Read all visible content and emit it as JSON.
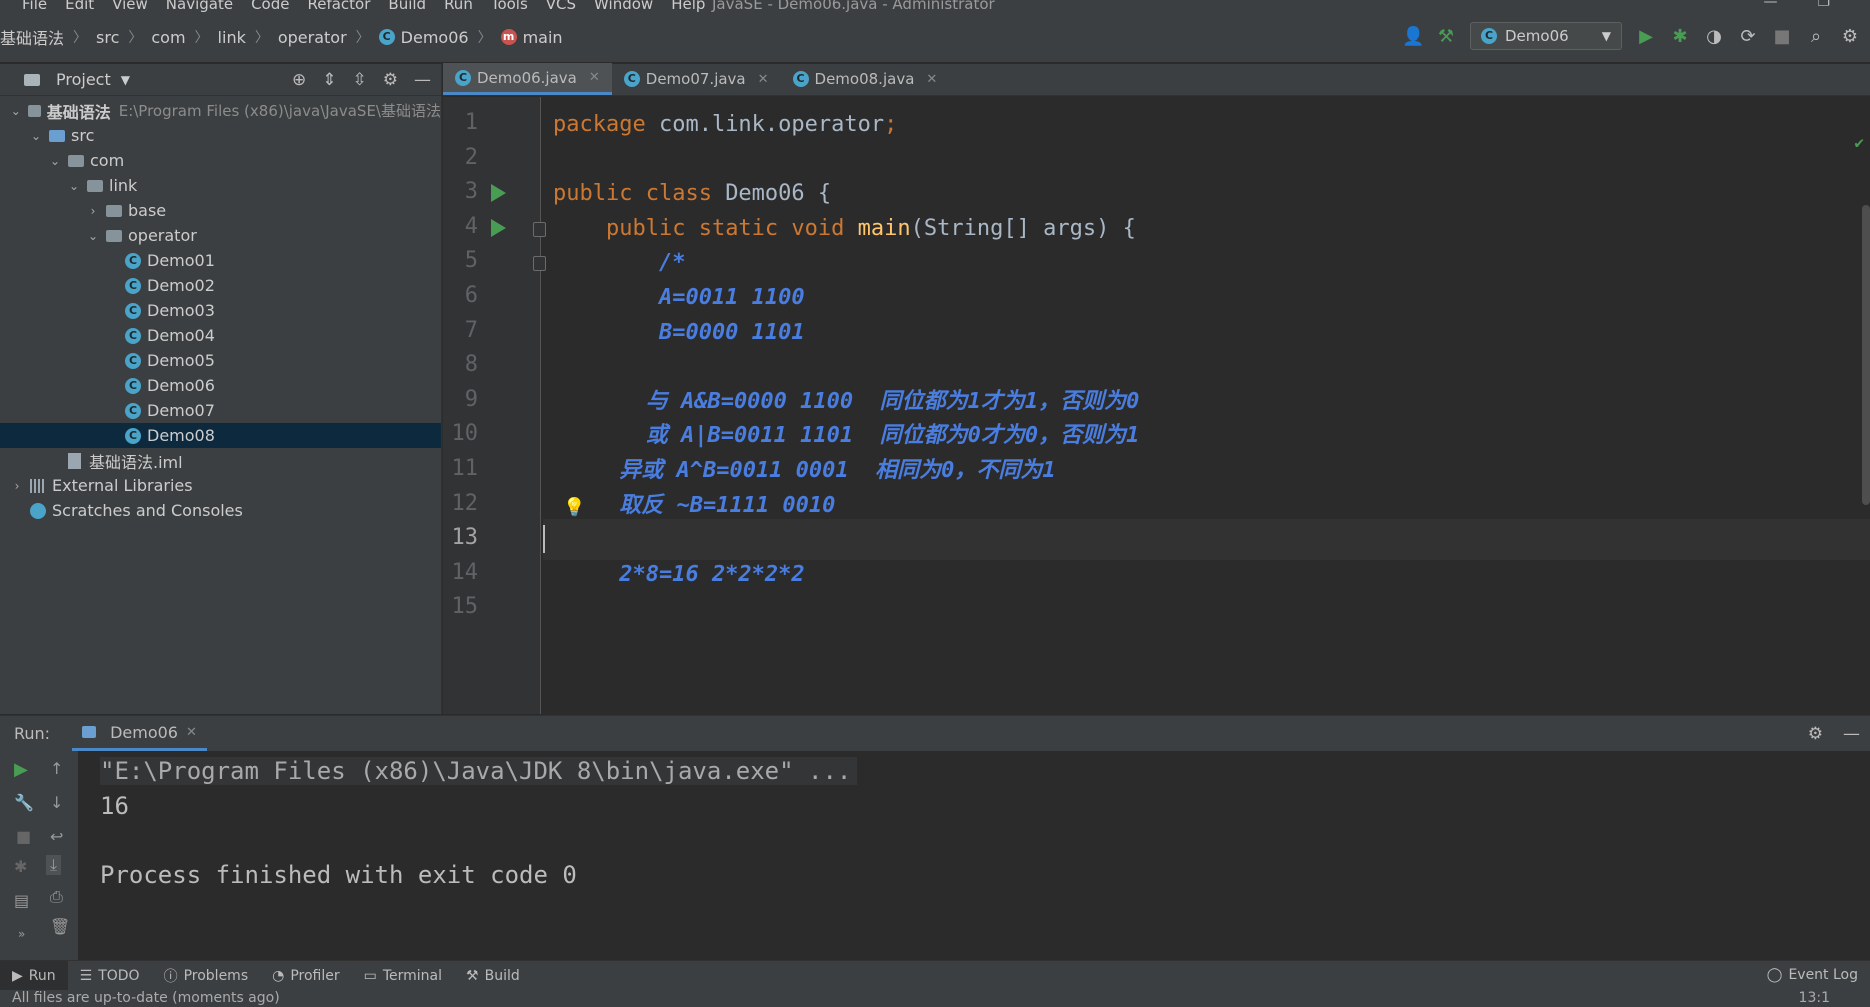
{
  "menu": {
    "items": [
      "File",
      "Edit",
      "View",
      "Navigate",
      "Code",
      "Refactor",
      "Build",
      "Run",
      "Tools",
      "VCS",
      "Window",
      "Help"
    ],
    "window_title": "JavaSE - Demo06.java - Administrator"
  },
  "breadcrumbs": [
    "基础语法",
    "src",
    "com",
    "link",
    "operator",
    "Demo06",
    "main"
  ],
  "toolbar": {
    "run_config": "Demo06"
  },
  "project": {
    "header": "Project",
    "tree": [
      {
        "label": "基础语法",
        "path": "E:\\Program Files (x86)\\java\\JavaSE\\基础语法",
        "depth": 0,
        "kind": "module",
        "expanded": true
      },
      {
        "label": "src",
        "depth": 1,
        "kind": "src",
        "expanded": true
      },
      {
        "label": "com",
        "depth": 2,
        "kind": "package",
        "expanded": true
      },
      {
        "label": "link",
        "depth": 3,
        "kind": "package",
        "expanded": true
      },
      {
        "label": "base",
        "depth": 4,
        "kind": "package",
        "expanded": false
      },
      {
        "label": "operator",
        "depth": 4,
        "kind": "package",
        "expanded": true
      },
      {
        "label": "Demo01",
        "depth": 5,
        "kind": "class"
      },
      {
        "label": "Demo02",
        "depth": 5,
        "kind": "class"
      },
      {
        "label": "Demo03",
        "depth": 5,
        "kind": "class"
      },
      {
        "label": "Demo04",
        "depth": 5,
        "kind": "class"
      },
      {
        "label": "Demo05",
        "depth": 5,
        "kind": "class"
      },
      {
        "label": "Demo06",
        "depth": 5,
        "kind": "class"
      },
      {
        "label": "Demo07",
        "depth": 5,
        "kind": "class"
      },
      {
        "label": "Demo08",
        "depth": 5,
        "kind": "class",
        "selected": true
      },
      {
        "label": "基础语法.iml",
        "depth": 2,
        "kind": "file"
      },
      {
        "label": "External Libraries",
        "depth": 0,
        "kind": "libs",
        "expanded": false
      },
      {
        "label": "Scratches and Consoles",
        "depth": 0,
        "kind": "scratch"
      }
    ]
  },
  "editor": {
    "tabs": [
      {
        "label": "Demo06.java",
        "active": true
      },
      {
        "label": "Demo07.java",
        "active": false
      },
      {
        "label": "Demo08.java",
        "active": false
      }
    ],
    "current_line": 13,
    "lines": [
      {
        "n": "1",
        "segs": [
          [
            "kw",
            "package"
          ],
          [
            "pl",
            " com.link.operator"
          ],
          [
            "kw",
            ";"
          ]
        ]
      },
      {
        "n": "2",
        "segs": []
      },
      {
        "n": "3",
        "segs": [
          [
            "kw",
            "public class "
          ],
          [
            "pl",
            "Demo06 {"
          ]
        ],
        "run": true
      },
      {
        "n": "4",
        "segs": [
          [
            "pl",
            "    "
          ],
          [
            "kw",
            "public static void "
          ],
          [
            "fn",
            "main"
          ],
          [
            "pl",
            "(String[] args) {"
          ]
        ],
        "run": true,
        "fold": true
      },
      {
        "n": "5",
        "segs": [
          [
            "cm",
            "        /*"
          ]
        ],
        "fold": true
      },
      {
        "n": "6",
        "segs": [
          [
            "cm",
            "        A=0011 1100"
          ]
        ]
      },
      {
        "n": "7",
        "segs": [
          [
            "cm",
            "        B=0000 1101"
          ]
        ]
      },
      {
        "n": "8",
        "segs": []
      },
      {
        "n": "9",
        "segs": [
          [
            "cm",
            "       与 A&B=0000 1100  同位都为1才为1，否则为0"
          ]
        ]
      },
      {
        "n": "10",
        "segs": [
          [
            "cm",
            "       或 A|B=0011 1101  同位都为0才为0，否则为1"
          ]
        ]
      },
      {
        "n": "11",
        "segs": [
          [
            "cm",
            "     异或 A^B=0011 0001  相同为0，不同为1"
          ]
        ]
      },
      {
        "n": "12",
        "segs": [
          [
            "cm",
            "     取反 ~B=1111 0010"
          ]
        ],
        "bulb": true
      },
      {
        "n": "13",
        "segs": []
      },
      {
        "n": "14",
        "segs": [
          [
            "cm",
            "     2*8=16 2*2*2*2"
          ]
        ]
      },
      {
        "n": "15",
        "segs": []
      }
    ]
  },
  "run": {
    "label": "Run:",
    "tab": "Demo06",
    "console": [
      {
        "text": "\"E:\\Program Files (x86)\\Java\\JDK 8\\bin\\java.exe\" ...",
        "cmd": true
      },
      {
        "text": "16"
      },
      {
        "text": ""
      },
      {
        "text": "Process finished with exit code 0"
      }
    ]
  },
  "bottom_tools": [
    "Run",
    "TODO",
    "Problems",
    "Profiler",
    "Terminal",
    "Build"
  ],
  "event_log": "Event Log",
  "status": {
    "message": "All files are up-to-date (moments ago)",
    "position": "13:1"
  },
  "colors": {
    "accent": "#4a88c7",
    "run_green": "#499c54",
    "keyword": "#cc7832",
    "comment": "#4a7de0",
    "selection": "#0d293e"
  }
}
